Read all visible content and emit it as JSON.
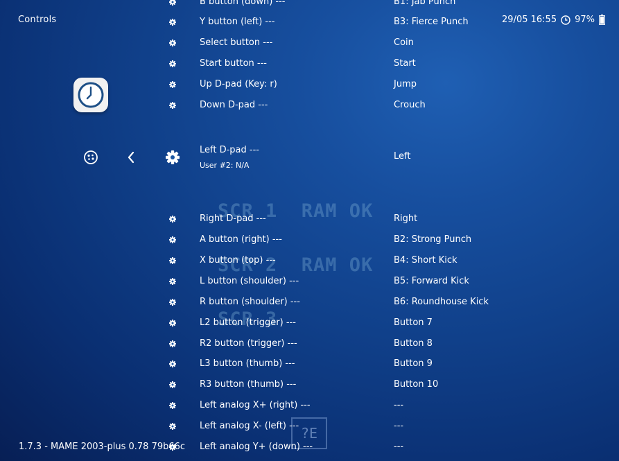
{
  "header": {
    "title": "Controls",
    "date_time": "29/05 16:55",
    "battery": "97%"
  },
  "icons": {
    "app": "clock-icon",
    "quick_menu": "quick-menu-icon",
    "back": "chevron-left-icon",
    "settings": "gear-icon",
    "row": "gear-icon"
  },
  "watermark": {
    "lines": [
      "SCR 1  RAM OK",
      "SCR 2  RAM OK",
      "SCR 3"
    ]
  },
  "badge": {
    "text": "?E"
  },
  "rows": [
    {
      "label": "B button (down) ---",
      "value": "B1: Jab Punch"
    },
    {
      "label": "Y button (left) ---",
      "value": "B3: Fierce Punch"
    },
    {
      "label": "Select button ---",
      "value": "Coin"
    },
    {
      "label": "Start button ---",
      "value": "Start"
    },
    {
      "label": "Up D-pad (Key: r)",
      "value": "Jump"
    },
    {
      "label": "Down D-pad ---",
      "value": "Crouch"
    },
    {
      "label": "Left D-pad ---",
      "sublabel": "User #2: N/A",
      "value": "Left"
    },
    {
      "label": "Right D-pad ---",
      "value": "Right"
    },
    {
      "label": "A button (right) ---",
      "value": "B2: Strong Punch"
    },
    {
      "label": "X button (top) ---",
      "value": "B4: Short Kick"
    },
    {
      "label": "L button (shoulder) ---",
      "value": "B5: Forward Kick"
    },
    {
      "label": "R button (shoulder) ---",
      "value": "B6: Roundhouse Kick"
    },
    {
      "label": "L2 button (trigger) ---",
      "value": "Button 7"
    },
    {
      "label": "R2 button (trigger) ---",
      "value": "Button 8"
    },
    {
      "label": "L3 button (thumb) ---",
      "value": "Button 9"
    },
    {
      "label": "R3 button (thumb) ---",
      "value": "Button 10"
    },
    {
      "label": "Left analog X+ (right) ---",
      "value": "---"
    },
    {
      "label": "Left analog X- (left) ---",
      "value": "---"
    },
    {
      "label": "Left analog Y+ (down) ---",
      "value": "---"
    }
  ],
  "footer": {
    "version": "1.7.3 - MAME 2003-plus 0.78 79b66c"
  }
}
